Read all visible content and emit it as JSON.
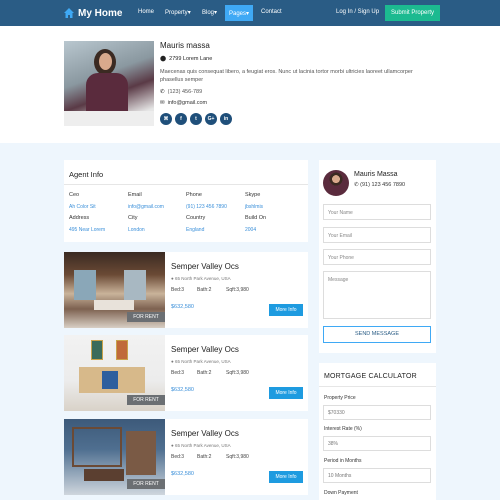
{
  "nav": {
    "brand": "My Home",
    "items": [
      "Home",
      "Property",
      "Blog",
      "Pages",
      "Contact"
    ],
    "login": "Log In / Sign Up",
    "submit": "Submit Property",
    "accent": "#2a5c85",
    "active_color": "#3fa9f5",
    "submit_color": "#1cba90"
  },
  "profile": {
    "name": "Mauris massa",
    "address": "2799 Lorem Lane",
    "description": "Maecenas quis consequat libero, a feugiat eros. Nunc ut lacinia tortor morbi ultricies laoreet ullamcorper phasellus semper",
    "phone": "(123) 456-789",
    "email": "info@gmail.com",
    "social_icons": [
      "rss-icon",
      "facebook-icon",
      "twitter-icon",
      "google-plus-icon",
      "linkedin-icon"
    ],
    "social_glyphs": [
      "⌘",
      "f",
      "t",
      "G+",
      "in"
    ]
  },
  "agent_info": {
    "title": "Agent Info",
    "fields": [
      {
        "label": "Ceo",
        "value": "Ah Color Sit"
      },
      {
        "label": "Email",
        "value": "info@gmail.com"
      },
      {
        "label": "Phone",
        "value": "(91) 123 456 7890"
      },
      {
        "label": "Skype",
        "value": "jbshlmis"
      },
      {
        "label": "Address",
        "value": "495 Near Lorem"
      },
      {
        "label": "City",
        "value": "London"
      },
      {
        "label": "Country",
        "value": "England"
      },
      {
        "label": "Build On",
        "value": "2004"
      }
    ]
  },
  "listings": [
    {
      "badge": "FOR RENT",
      "title": "Semper Valley Ocs",
      "address": "65 North Park Avenue, USA",
      "bed": "Bed:3",
      "bath": "Bath:2",
      "sqft": "Sqft:3,980",
      "price": "$632,580",
      "button": "More Info"
    },
    {
      "badge": "FOR RENT",
      "title": "Semper Valley Ocs",
      "address": "65 North Park Avenue, USA",
      "bed": "Bed:3",
      "bath": "Bath:2",
      "sqft": "Sqft:3,980",
      "price": "$632,580",
      "button": "More Info"
    },
    {
      "badge": "FOR RENT",
      "title": "Semper Valley Ocs",
      "address": "65 North Park Avenue, USA",
      "bed": "Bed:3",
      "bath": "Bath:2",
      "sqft": "Sqft:3,980",
      "price": "$632,580",
      "button": "More Info"
    }
  ],
  "contact": {
    "name": "Mauris Massa",
    "phone": "(91) 123 456 7890",
    "name_placeholder": "Your Name",
    "email_placeholder": "Your Email",
    "phone_placeholder": "Your Phone",
    "message_placeholder": "Message",
    "send": "SEND MESSAGE"
  },
  "mortgage": {
    "title": "MORTGAGE CALCULATOR",
    "price_label": "Property Price",
    "price_value": "$70330",
    "rate_label": "Interest Rate (%)",
    "rate_value": "38%",
    "period_label": "Period in Months",
    "period_value": "10 Months",
    "down_label": "Down Payment"
  }
}
